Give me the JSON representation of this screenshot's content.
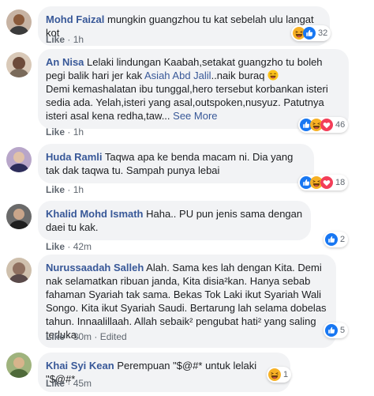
{
  "comments": [
    {
      "name": "Mohd Faizal",
      "text": " mungkin guangzhou tu kat sebelah ulu langat kot",
      "like": "Like",
      "time": "1h",
      "reaction_count": "32"
    },
    {
      "name": "An Nisa",
      "text_part1": " Lelaki lindungan Kaabah,setakat guangzho tu boleh pegi balik hari jer kak ",
      "tag": "Asiah Abd Jalil",
      "text_part2": "..naik buraq ",
      "text_part3": "Demi kemashalatan ibu tunggal,hero tersebut korbankan isteri sedia ada. Yelah,isteri yang asal,outspoken,nusyuz. Patutnya isteri asal kena redha,taw...",
      "see_more": "See More",
      "like": "Like",
      "time": "1h",
      "reaction_count": "46"
    },
    {
      "name": "Huda Ramli",
      "text": " Taqwa apa ke benda macam ni. Dia yang tak dak taqwa tu. Sampah punya lebai",
      "like": "Like",
      "time": "1h",
      "reaction_count": "18"
    },
    {
      "name": "Khalid Mohd Ismath",
      "text": " Haha.. PU pun jenis sama dengan daei tu kak.",
      "like": "Like",
      "time": "42m",
      "reaction_count": "2"
    },
    {
      "name": "Nurussaadah Salleh",
      "text": " Alah. Sama kes lah dengan Kita. Demi nak selamatkan ribuan janda, Kita disia²kan. Hanya sebab fahaman Syariah tak sama. Bekas Tok Laki ikut Syariah Wali Songo. Kita ikut Syariah Saudi. Bertarung lah selama dobelas tahun. Innaalillaah. Allah sebaik² pengubat hati² yang saling terluka.",
      "like": "Like",
      "time": "30m",
      "edited": "Edited",
      "reaction_count": "5"
    },
    {
      "name": "Khai Syi Kean",
      "text": " Perempuan \"$@#* untuk lelaki \"$@#*",
      "like": "Like",
      "time": "45m",
      "reaction_count": "1"
    }
  ],
  "colors": {
    "name_link": "#385898",
    "bubble_bg": "#f2f3f5",
    "meta_text": "#606770",
    "like_blue": "#1877f2",
    "love_red": "#f33e58",
    "haha_yellow": "#f7b125"
  },
  "icons": [
    "like-reaction-icon",
    "haha-reaction-icon",
    "love-reaction-icon",
    "laughing-emoji-icon"
  ]
}
